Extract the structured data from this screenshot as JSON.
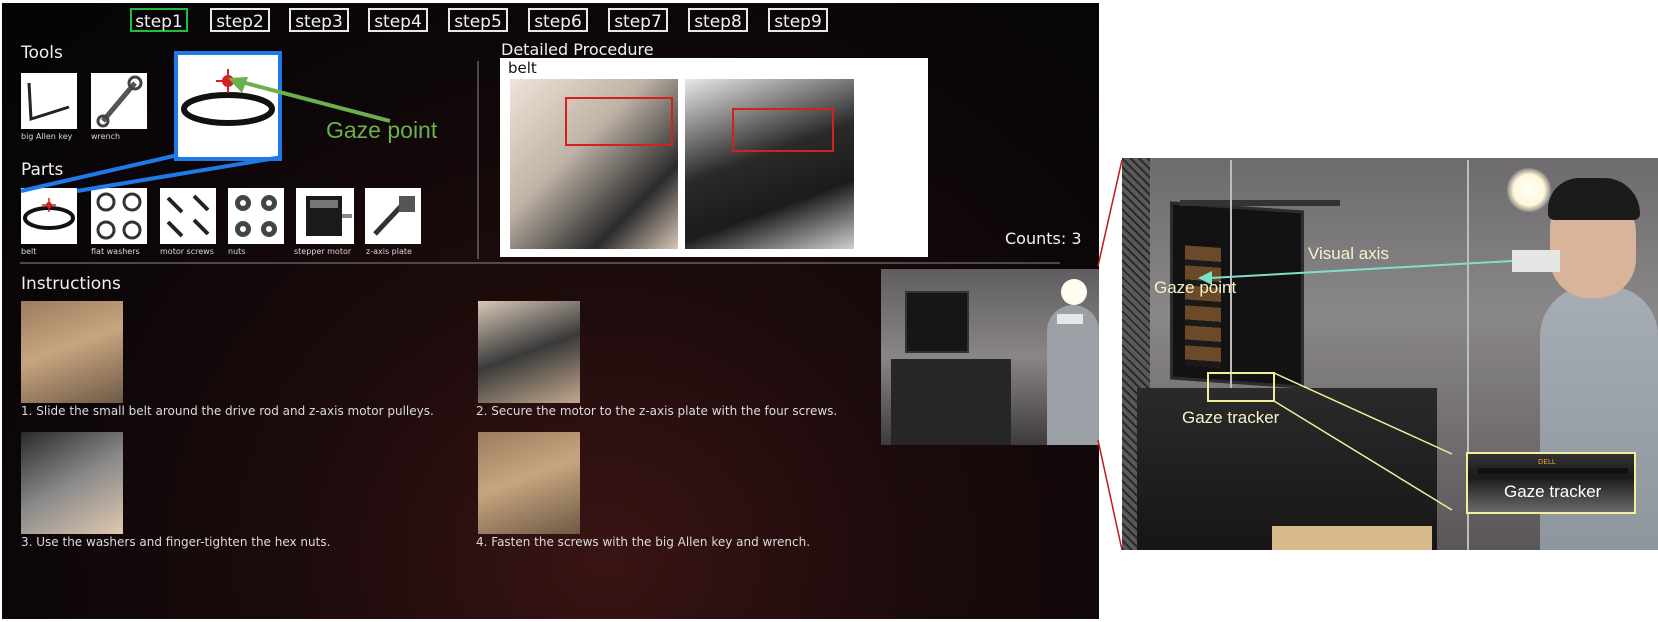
{
  "steps": [
    "step1",
    "step2",
    "step3",
    "step4",
    "step5",
    "step6",
    "step7",
    "step8",
    "step9"
  ],
  "active_step": "step1",
  "tools": {
    "heading": "Tools",
    "items": [
      {
        "caption": "big Allen key"
      },
      {
        "caption": "wrench"
      }
    ]
  },
  "gaze_label": "Gaze point",
  "parts": {
    "heading": "Parts",
    "items": [
      {
        "caption": "belt"
      },
      {
        "caption": "flat washers"
      },
      {
        "caption": "motor screws"
      },
      {
        "caption": "nuts"
      },
      {
        "caption": "stepper motor"
      },
      {
        "caption": "z-axis plate"
      }
    ]
  },
  "detail": {
    "heading": "Detailed Procedure",
    "part_label": "belt"
  },
  "counts_label": "Counts: 3",
  "instructions": {
    "heading": "Instructions",
    "items": [
      {
        "text": "1. Slide the small belt around the drive rod and z-axis motor pulleys."
      },
      {
        "text": "2. Secure the motor to the z-axis plate with the four screws."
      },
      {
        "text": "3. Use the washers and finger-tighten the hex nuts."
      },
      {
        "text": "4. Fasten the screws with the big Allen key and wrench."
      }
    ]
  },
  "photo_annotations": {
    "visual_axis": "Visual axis",
    "gaze_point": "Gaze point",
    "gaze_tracker": "Gaze tracker",
    "gaze_tracker_inset": "Gaze tracker",
    "inset_brand": "DELL"
  },
  "colors": {
    "active_step_border": "#1fbf3a",
    "gaze_green": "#6ab04c",
    "highlight_blue": "#1f7ae8",
    "detail_box_red": "#d42020",
    "zoom_line_red": "#c01818",
    "tracker_yellow": "#f2ee9a",
    "axis_teal": "#7ee0c8"
  }
}
